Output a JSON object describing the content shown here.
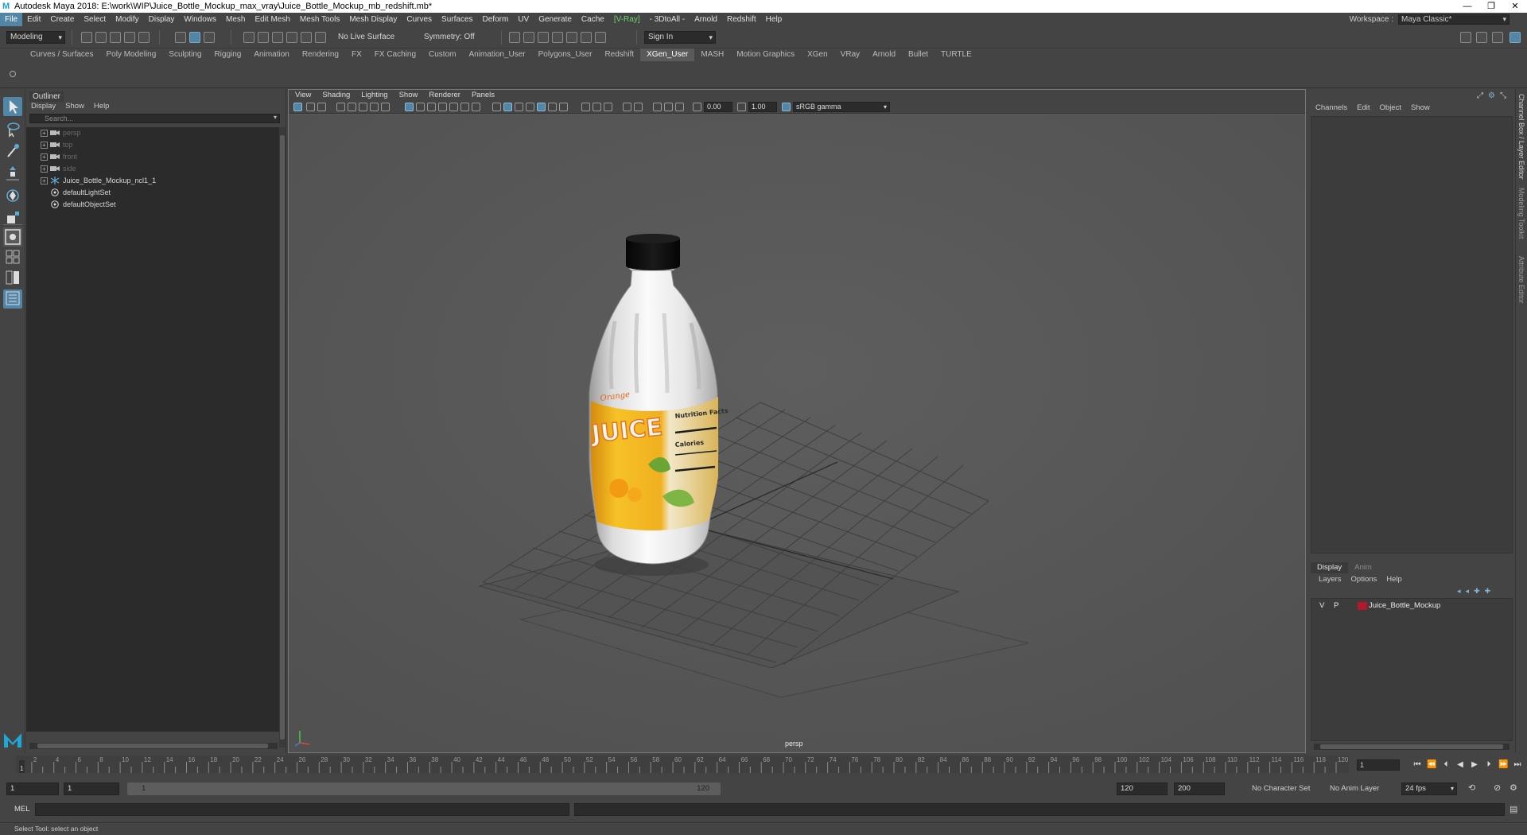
{
  "window": {
    "title": "Autodesk Maya 2018: E:\\work\\WIP\\Juice_Bottle_Mockup_max_vray\\Juice_Bottle_Mockup_mb_redshift.mb*",
    "controls": [
      "—",
      "❐",
      "✕"
    ]
  },
  "menubar": {
    "items": [
      "File",
      "Edit",
      "Create",
      "Select",
      "Modify",
      "Display",
      "Windows",
      "Mesh",
      "Edit Mesh",
      "Mesh Tools",
      "Mesh Display",
      "Curves",
      "Surfaces",
      "Deform",
      "UV",
      "Generate",
      "Cache",
      "V-Ray",
      "- 3DtoAll -",
      "Arnold",
      "Redshift",
      "Help"
    ],
    "active": "File",
    "workspace_label": "Workspace :",
    "workspace_value": "Maya Classic*"
  },
  "statusline": {
    "mode": "Modeling",
    "live_surface": "No Live Surface",
    "symmetry": "Symmetry: Off",
    "sign_in": "Sign In"
  },
  "shelf": {
    "tabs": [
      "Curves / Surfaces",
      "Poly Modeling",
      "Sculpting",
      "Rigging",
      "Animation",
      "Rendering",
      "FX",
      "FX Caching",
      "Custom",
      "Animation_User",
      "Polygons_User",
      "Redshift",
      "XGen_User",
      "MASH",
      "Motion Graphics",
      "XGen",
      "VRay",
      "Arnold",
      "Bullet",
      "TURTLE"
    ],
    "active": "XGen_User"
  },
  "outliner": {
    "title": "Outliner",
    "menu": [
      "Display",
      "Show",
      "Help"
    ],
    "search_placeholder": "Search...",
    "items": [
      {
        "label": "persp",
        "type": "camera",
        "dim": true,
        "expand": true
      },
      {
        "label": "top",
        "type": "camera",
        "dim": true,
        "expand": true
      },
      {
        "label": "front",
        "type": "camera",
        "dim": true,
        "expand": true
      },
      {
        "label": "side",
        "type": "camera",
        "dim": true,
        "expand": true
      },
      {
        "label": "Juice_Bottle_Mockup_ncl1_1",
        "type": "transform",
        "dim": false,
        "expand": true
      },
      {
        "label": "defaultLightSet",
        "type": "set",
        "dim": false,
        "expand": false
      },
      {
        "label": "defaultObjectSet",
        "type": "set",
        "dim": false,
        "expand": false
      }
    ]
  },
  "viewport": {
    "menu": [
      "View",
      "Shading",
      "Lighting",
      "Show",
      "Renderer",
      "Panels"
    ],
    "exposure": "0.00",
    "gamma": "1.00",
    "color_space": "sRGB gamma",
    "camera_label": "persp",
    "label_brand": "Orange",
    "label_main": "JUICE",
    "label_side": "Nutrition Facts",
    "label_calories": "Calories"
  },
  "channelbox": {
    "menu": [
      "Channels",
      "Edit",
      "Object",
      "Show"
    ],
    "layer_tabs": [
      "Display",
      "Anim"
    ],
    "layer_menu": [
      "Layers",
      "Options",
      "Help"
    ],
    "layer": {
      "v": "V",
      "p": "P",
      "name": "Juice_Bottle_Mockup",
      "color": "#b4162c"
    },
    "side_tabs": [
      "Channel Box / Layer Editor",
      "Modeling Toolkit",
      "Attribute Editor"
    ]
  },
  "timeline": {
    "ticks": [
      "2",
      "4",
      "6",
      "8",
      "10",
      "12",
      "14",
      "16",
      "18",
      "20",
      "22",
      "24",
      "26",
      "28",
      "30",
      "32",
      "34",
      "36",
      "38",
      "40",
      "42",
      "44",
      "46",
      "48",
      "50",
      "52",
      "54",
      "56",
      "58",
      "60",
      "62",
      "64",
      "66",
      "68",
      "70",
      "72",
      "74",
      "76",
      "78",
      "80",
      "82",
      "84",
      "86",
      "88",
      "90",
      "92",
      "94",
      "96",
      "98",
      "100",
      "102",
      "104",
      "106",
      "108",
      "110",
      "112",
      "114",
      "116",
      "118",
      "120"
    ],
    "current_frame": "1",
    "start_label": "1"
  },
  "range": {
    "start": "1",
    "playback_start": "1",
    "range_start": "1",
    "range_end": "120",
    "playback_end": "120",
    "end": "200",
    "character_set": "No Character Set",
    "anim_layer": "No Anim Layer",
    "fps": "24 fps"
  },
  "command": {
    "language": "MEL"
  },
  "help_line": "Select Tool: select an object"
}
